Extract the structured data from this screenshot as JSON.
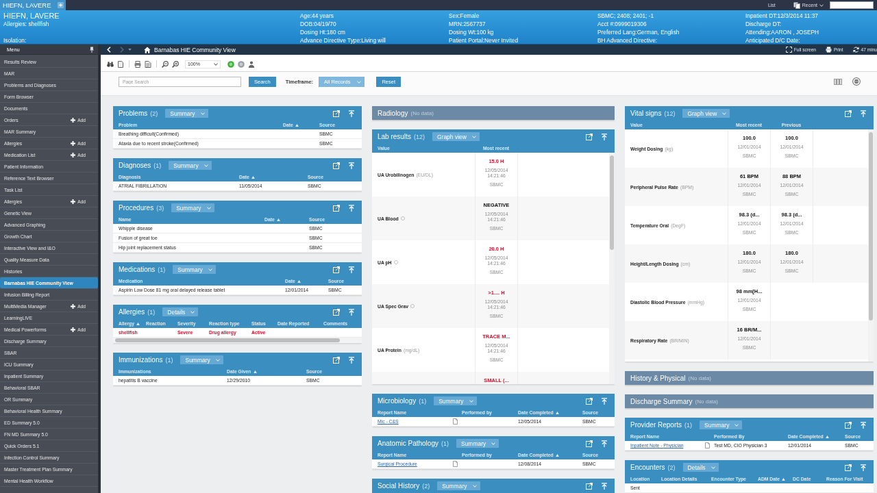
{
  "topbar": {
    "patient_tab": "HIEFN, LAVERE",
    "list_link": "List",
    "recent": "Recent"
  },
  "banner": {
    "name": "HIEFN, LAVERE",
    "allergies": "Allergies: shellfish",
    "isolation": "Isolation:",
    "columns": [
      [
        "Age:44 years",
        "DOB:04/19/70",
        "Dosing Ht:180 cm",
        "Advance Directive Type:Living will"
      ],
      [
        "Sex:Female",
        "MRN:2567737",
        "Dosing Wt:100 kg",
        "Patient Portal:Never Invited"
      ],
      [
        "SBMC; 2408; 2401; -1",
        "Acct #:0999019306",
        "Preferred Lang:German, English",
        "BH Advanced Directive:"
      ],
      [
        "Inpatient DT:12/3/2014 11:37",
        "Discharge DT:",
        "Attending:AARON , JOSEPH",
        "Anticipated D/C Date:"
      ]
    ]
  },
  "sidebar": {
    "title": "Menu",
    "items": [
      {
        "label": "Results Review",
        "selected": false
      },
      {
        "label": "MAR",
        "selected": false
      },
      {
        "label": "Problems and Diagnoses",
        "selected": false
      },
      {
        "label": "Form Browser",
        "selected": false
      },
      {
        "label": "Documents",
        "selected": false
      },
      {
        "label": "Orders",
        "selected": false,
        "action": "Add"
      },
      {
        "label": "MAR Summary",
        "selected": false
      },
      {
        "label": "Allergies",
        "selected": false,
        "action": "Add"
      },
      {
        "label": "Medication List",
        "selected": false,
        "action": "Add"
      },
      {
        "label": "Patient Information",
        "selected": false
      },
      {
        "label": "Reference Text Browser",
        "selected": false
      },
      {
        "label": "Task List",
        "selected": false
      },
      {
        "label": "Allergies",
        "selected": false,
        "action": "Add"
      },
      {
        "label": "Genetic View",
        "selected": false
      },
      {
        "label": "Advanced Graphing",
        "selected": false
      },
      {
        "label": "Growth Chart",
        "selected": false
      },
      {
        "label": "Interactive View and I&O",
        "selected": false
      },
      {
        "label": "Quality Measure Data",
        "selected": false
      },
      {
        "label": "Histories",
        "selected": false
      },
      {
        "label": "Barnabas HIE Community View",
        "selected": true
      },
      {
        "label": "Infusion Billing Report",
        "selected": false
      },
      {
        "label": "MultiMedia Manager",
        "selected": false,
        "action": "Add"
      },
      {
        "label": "LearningLIVE",
        "selected": false
      },
      {
        "label": "Medical Powerforms",
        "selected": false,
        "action": "Add"
      },
      {
        "label": "Discharge Summary",
        "selected": false
      },
      {
        "label": "SBAR",
        "selected": false
      },
      {
        "label": "ICU Summary",
        "selected": false
      },
      {
        "label": "Inpatient Summary",
        "selected": false
      },
      {
        "label": "Behavioral SBAR",
        "selected": false
      },
      {
        "label": "OR Summary",
        "selected": false
      },
      {
        "label": "Behavioral Health Summary",
        "selected": false
      },
      {
        "label": "ED Summary 5.0",
        "selected": false
      },
      {
        "label": "FN MD Summary 5.0",
        "selected": false
      },
      {
        "label": "Quick Orders 5.1",
        "selected": false
      },
      {
        "label": "Infection Control Summary",
        "selected": false
      },
      {
        "label": "Master Treatment Plan Summary",
        "selected": false
      },
      {
        "label": "Mental Health Workflow",
        "selected": false
      }
    ]
  },
  "nav": {
    "title": "Barnabas HIE Community View",
    "forward_disabled": true,
    "actions": [
      {
        "kind": "fullscreen",
        "label": "Full screen"
      },
      {
        "kind": "print",
        "label": "Print"
      },
      {
        "kind": "refresh",
        "label": "47 minu"
      }
    ]
  },
  "toolbar": {
    "zoom": "100%"
  },
  "search": {
    "placeholder": "Page Search",
    "button": "Search",
    "timeframe_label": "Timeframe:",
    "timeframe": "All Records",
    "reset": "Reset"
  },
  "columns": [
    [
      {
        "kind": "table",
        "title": "Problems",
        "count": "(2)",
        "view": "Summary",
        "columns": [
          {
            "label": "Problem",
            "sorted": false
          },
          {
            "label": "Date",
            "sorted": true
          },
          {
            "label": "Source",
            "sorted": false
          }
        ],
        "rows": [
          {
            "cells": [
              "Breathing difficult(Confirmed)",
              null,
              "SBMC"
            ]
          },
          {
            "cells": [
              "Ataxia due to recent stroke(Confirmed)",
              null,
              "SBMC"
            ]
          }
        ]
      },
      {
        "kind": "table",
        "title": "Diagnoses",
        "count": "(1)",
        "view": "Summary",
        "columns": [
          {
            "label": "Diagnosis",
            "sorted": false
          },
          {
            "label": "Date",
            "sorted": true
          },
          {
            "label": "Source",
            "sorted": false
          }
        ],
        "rows": [
          {
            "cells": [
              "ATRIAL FIBRILLATION",
              "11/05/2014",
              "SBMC"
            ]
          }
        ]
      },
      {
        "kind": "table",
        "title": "Procedures",
        "count": "(3)",
        "view": "Summary",
        "columns": [
          {
            "label": "Name",
            "sorted": false
          },
          {
            "label": "Date",
            "sorted": true
          },
          {
            "label": "Source",
            "sorted": false
          }
        ],
        "rows": [
          {
            "cells": [
              "Whipple disease",
              null,
              "SBMC"
            ]
          },
          {
            "cells": [
              "Fusion of great toe",
              null,
              "SBMC"
            ]
          },
          {
            "cells": [
              "Hip joint replacement status",
              null,
              "SBMC"
            ]
          }
        ]
      },
      {
        "kind": "table",
        "title": "Medications",
        "count": "(1)",
        "view": "Summary",
        "columns": [
          {
            "label": "Medication",
            "sorted": false
          },
          {
            "label": "Date",
            "sorted": true
          },
          {
            "label": "Source",
            "sorted": false
          }
        ],
        "rows": [
          {
            "cells": [
              "Aspirin Low Dose 81 mg oral delayed release tablet",
              "12/01/2014",
              "SBMC"
            ]
          }
        ]
      },
      {
        "kind": "table",
        "title": "Allergies",
        "count": "(1)",
        "view": "Details",
        "h_scrollbar": true,
        "columns": [
          {
            "label": "Allergy",
            "sorted": true
          },
          {
            "label": "Reaction",
            "sorted": false
          },
          {
            "label": "Severity",
            "sorted": false
          },
          {
            "label": "Reaction type",
            "sorted": false
          },
          {
            "label": "Status",
            "sorted": false
          },
          {
            "label": "Date Reported",
            "sorted": false
          },
          {
            "label": "Comments",
            "sorted": false
          }
        ],
        "rows": [
          {
            "alert": true,
            "cells": [
              "shellfish",
              null,
              "Severe",
              "Drug allergy",
              "Active",
              null,
              null
            ]
          }
        ]
      },
      {
        "kind": "table",
        "title": "Immunizations",
        "count": "(1)",
        "view": "Summary",
        "columns": [
          {
            "label": "Immunizations",
            "sorted": false
          },
          {
            "label": "Date Given",
            "sorted": true
          },
          {
            "label": "Source",
            "sorted": false
          }
        ],
        "rows": [
          {
            "cells": [
              "hepatitis B vaccine",
              "12/29/2010",
              "SBMC"
            ]
          }
        ]
      }
    ],
    [
      {
        "kind": "empty",
        "title": "Radiology",
        "note": "(No data)"
      },
      {
        "kind": "results",
        "title": "Lab results",
        "count": "(12)",
        "view": "Graph view",
        "columns": [
          "Value",
          "Most recent"
        ],
        "rows": [
          {
            "name": "UA Urobilinogen",
            "unit": "(EU/DL)",
            "info": false,
            "results": [
              {
                "value": "15.0 H",
                "abnormal": true,
                "date": "12/05/2014",
                "time": "14:21:46",
                "source": "SBMC"
              }
            ]
          },
          {
            "name": "UA Blood",
            "info": true,
            "results": [
              {
                "value": "NEGATIVE",
                "abnormal": false,
                "date": "12/05/2014",
                "time": "14:21:46",
                "source": "SBMC"
              }
            ]
          },
          {
            "name": "UA pH",
            "info": true,
            "results": [
              {
                "value": "20.0 H",
                "abnormal": true,
                "date": "12/05/2014",
                "time": "14:21:46",
                "source": "SBMC"
              }
            ]
          },
          {
            "name": "UA Spec Grav",
            "info": true,
            "results": [
              {
                "value": ">1.... H",
                "abnormal": true,
                "date": "12/05/2014",
                "time": "14:21:46",
                "source": "SBMC"
              }
            ]
          },
          {
            "name": "UA Protein",
            "unit": "(mg/dL)",
            "info": false,
            "results": [
              {
                "value": "TRACE M...",
                "abnormal": true,
                "date": "12/05/2014",
                "time": "14:21:46",
                "source": "SBMC"
              }
            ]
          },
          {
            "results": [
              {
                "value": "SMALL (...",
                "abnormal": true
              }
            ]
          }
        ]
      },
      {
        "kind": "reports",
        "title": "Microbiology",
        "count": "(1)",
        "view": "Summary",
        "columns": [
          {
            "label": "Report Name",
            "sorted": false
          },
          {
            "label": "Performed by",
            "sorted": false
          },
          {
            "label": "Date Completed",
            "sorted": true
          },
          {
            "label": "Source",
            "sorted": false
          }
        ],
        "rows": [
          {
            "cells": [
              "Mic - C&S",
              null,
              "12/05/2014",
              "SBMC"
            ]
          }
        ]
      },
      {
        "kind": "reports",
        "title": "Anatomic Pathology",
        "count": "(1)",
        "view": "Summary",
        "columns": [
          {
            "label": "Report Name",
            "sorted": false
          },
          {
            "label": "Performed by",
            "sorted": false
          },
          {
            "label": "Date Completed",
            "sorted": true
          },
          {
            "label": "Source",
            "sorted": false
          }
        ],
        "rows": [
          {
            "cells": [
              "Surgical Procedure",
              null,
              "12/08/2014",
              "SBMC"
            ]
          }
        ]
      },
      {
        "kind": "table",
        "title": "Social History",
        "count": "(2)",
        "view": "Summary"
      }
    ],
    [
      {
        "kind": "results",
        "title": "Vital signs",
        "count": "(12)",
        "view": "Graph view",
        "columns": [
          "Value",
          "Most recent",
          "Previous"
        ],
        "rows": [
          {
            "name": "Weight Dosing",
            "unit": "(kg)",
            "info": false,
            "results": [
              {
                "value": "100.0",
                "abnormal": false,
                "date": "12/01/2014",
                "source": "SBMC"
              },
              {
                "value": "100.0",
                "abnormal": false,
                "date": "12/01/2014",
                "source": "SBMC"
              }
            ]
          },
          {
            "name": "Peripheral Pulse Rate",
            "unit": "(BPM)",
            "info": false,
            "results": [
              {
                "value": "61 BPM",
                "abnormal": false,
                "date": "12/01/2014",
                "source": "SBMC"
              },
              {
                "value": "88 BPM",
                "abnormal": false,
                "date": "12/01/2014",
                "source": "SBMC"
              }
            ]
          },
          {
            "name": "Temperature Oral",
            "unit": "(DegF)",
            "info": false,
            "results": [
              {
                "value": "98.3 (d...",
                "abnormal": false,
                "date": "12/01/2014",
                "source": "SBMC"
              },
              {
                "value": "98.3 (d...",
                "abnormal": false,
                "date": "12/01/2014",
                "source": "SBMC"
              }
            ]
          },
          {
            "name": "Height/Length Dosing",
            "unit": "(cm)",
            "info": false,
            "results": [
              {
                "value": "180.0",
                "abnormal": false,
                "date": "12/01/2014",
                "source": "SBMC"
              },
              {
                "value": "180.0",
                "abnormal": false,
                "date": "12/01/2014",
                "source": "SBMC"
              }
            ]
          },
          {
            "name": "Diastolic Blood Pressure",
            "unit": "(mmHg)",
            "info": false,
            "results": [
              {
                "value": "98 mm[H...",
                "abnormal": false,
                "date": "12/01/2014",
                "source": "SBMC"
              }
            ]
          },
          {
            "name": "Respiratory Rate",
            "unit": "(BR/MIN)",
            "info": false,
            "results": [
              {
                "value": "16 BR/M...",
                "abnormal": false,
                "date": "12/01/2014",
                "source": "SBMC"
              }
            ]
          }
        ]
      },
      {
        "kind": "empty",
        "title": "History & Physical",
        "note": "(No data)"
      },
      {
        "kind": "empty",
        "title": "Discharge Summary",
        "note": "(No data)"
      },
      {
        "kind": "reports",
        "title": "Provider Reports",
        "count": "(1)",
        "view": "Summary",
        "columns": [
          {
            "label": "Report Name",
            "sorted": false
          },
          {
            "label": "Performed By",
            "sorted": false
          },
          {
            "label": "Date Completed",
            "sorted": true
          },
          {
            "label": "Source",
            "sorted": false
          }
        ],
        "rows": [
          {
            "cells": [
              "Inpatient Note - Physician",
              "Test MD, CIO Physician 3",
              "12/01/2014",
              "SBMC"
            ]
          }
        ]
      },
      {
        "kind": "table",
        "title": "Encounters",
        "count": "(2)",
        "view": "Details",
        "columns": [
          {
            "label": "Location",
            "sorted": false
          },
          {
            "label": "Location Details",
            "sorted": false
          },
          {
            "label": "Encounter Type",
            "sorted": false
          },
          {
            "label": "ADM Date",
            "sorted": true
          },
          {
            "label": "DC Date",
            "sorted": false
          },
          {
            "label": "Reason For Visit",
            "sorted": false
          }
        ],
        "rows": [
          {
            "cells": [
              "Sent",
              null,
              null,
              null,
              null,
              null
            ]
          }
        ]
      }
    ]
  ]
}
